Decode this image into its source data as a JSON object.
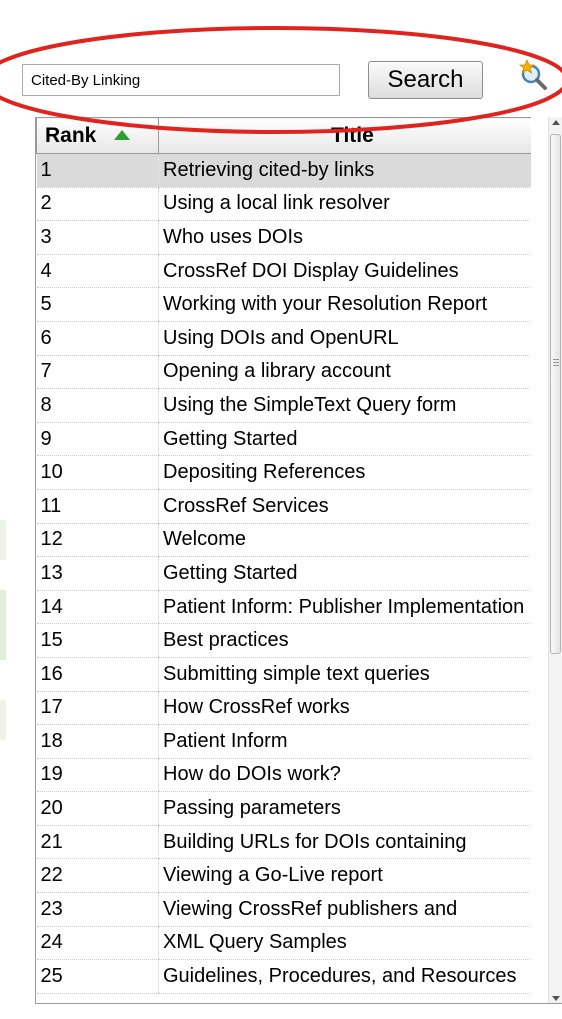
{
  "search": {
    "value": "Cited-By Linking",
    "button_label": "Search"
  },
  "table": {
    "columns": [
      {
        "label": "Rank",
        "sorted": "ascending"
      },
      {
        "label": "Title"
      }
    ],
    "selected_rank": "1",
    "rows": [
      {
        "rank": "1",
        "title": "Retrieving cited-by links"
      },
      {
        "rank": "2",
        "title": "Using a local link resolver"
      },
      {
        "rank": "3",
        "title": "Who uses DOIs"
      },
      {
        "rank": "4",
        "title": "CrossRef DOI Display Guidelines"
      },
      {
        "rank": "5",
        "title": "Working with your Resolution Report"
      },
      {
        "rank": "6",
        "title": "Using DOIs and OpenURL"
      },
      {
        "rank": "7",
        "title": "Opening a library account"
      },
      {
        "rank": "8",
        "title": "Using the SimpleText Query form"
      },
      {
        "rank": "9",
        "title": "Getting Started"
      },
      {
        "rank": "10",
        "title": "Depositing References"
      },
      {
        "rank": "11",
        "title": "CrossRef Services"
      },
      {
        "rank": "12",
        "title": "Welcome"
      },
      {
        "rank": "13",
        "title": "Getting Started"
      },
      {
        "rank": "14",
        "title": "Patient Inform: Publisher Implementation"
      },
      {
        "rank": "15",
        "title": "Best practices"
      },
      {
        "rank": "16",
        "title": "Submitting simple text queries"
      },
      {
        "rank": "17",
        "title": "How CrossRef works"
      },
      {
        "rank": "18",
        "title": "Patient Inform"
      },
      {
        "rank": "19",
        "title": "How do DOIs work?"
      },
      {
        "rank": "20",
        "title": "Passing parameters"
      },
      {
        "rank": "21",
        "title": "Building URLs for DOIs containing"
      },
      {
        "rank": "22",
        "title": "Viewing a Go-Live report"
      },
      {
        "rank": "23",
        "title": "Viewing CrossRef publishers and"
      },
      {
        "rank": "24",
        "title": "XML Query Samples"
      },
      {
        "rank": "25",
        "title": "Guidelines, Procedures, and Resources"
      }
    ]
  },
  "icons": {
    "help": "search-help-icon",
    "sort": "sort-ascending-icon"
  },
  "colors": {
    "annotation": "#e0231e",
    "sort_arrow": "#2e9e2e",
    "selected_row": "#dadada"
  }
}
